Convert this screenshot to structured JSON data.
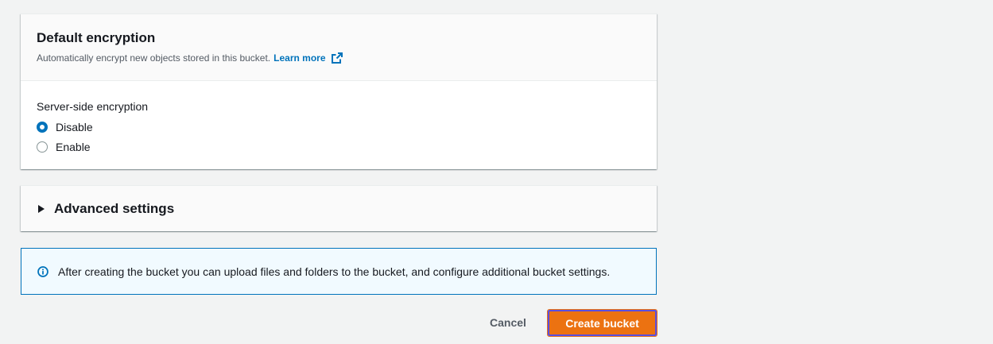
{
  "encryption": {
    "title": "Default encryption",
    "description": "Automatically encrypt new objects stored in this bucket.",
    "learn_more": "Learn more",
    "field_label": "Server-side encryption",
    "options": [
      {
        "label": "Disable",
        "selected": true
      },
      {
        "label": "Enable",
        "selected": false
      }
    ]
  },
  "advanced": {
    "title": "Advanced settings",
    "expanded": false
  },
  "info": {
    "icon": "info-icon",
    "text": "After creating the bucket you can upload files and folders to the bucket, and configure additional bucket settings."
  },
  "actions": {
    "cancel_label": "Cancel",
    "create_label": "Create bucket"
  },
  "colors": {
    "primary_button": "#ec7211",
    "link": "#0073bb",
    "focus_ring": "#5a4fe0"
  }
}
